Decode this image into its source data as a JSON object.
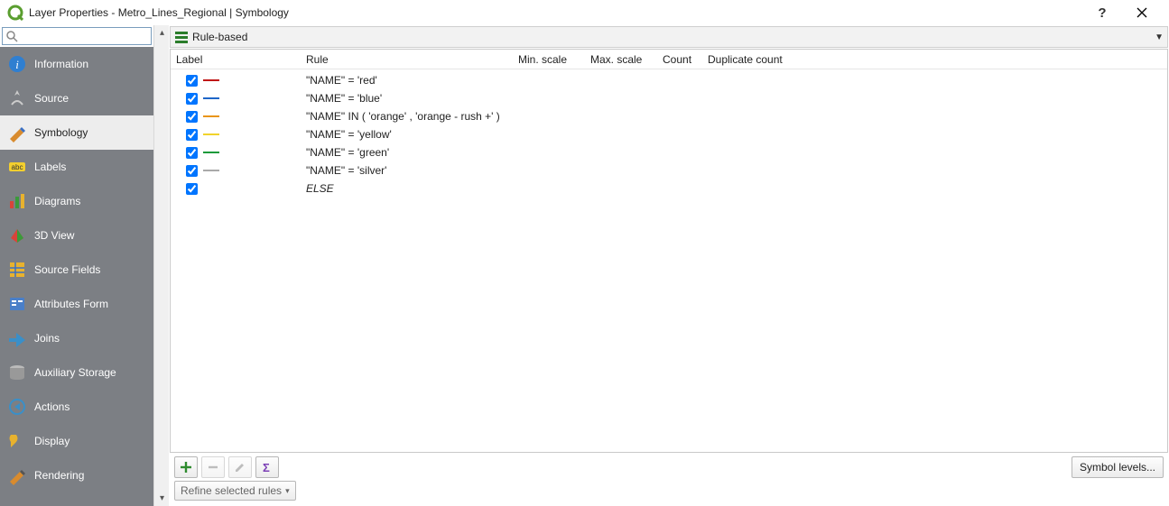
{
  "titlebar": {
    "title": "Layer Properties - Metro_Lines_Regional | Symbology"
  },
  "sidebar": {
    "search_placeholder": "",
    "items": [
      {
        "label": "Information"
      },
      {
        "label": "Source"
      },
      {
        "label": "Symbology"
      },
      {
        "label": "Labels"
      },
      {
        "label": "Diagrams"
      },
      {
        "label": "3D View"
      },
      {
        "label": "Source Fields"
      },
      {
        "label": "Attributes Form"
      },
      {
        "label": "Joins"
      },
      {
        "label": "Auxiliary Storage"
      },
      {
        "label": "Actions"
      },
      {
        "label": "Display"
      },
      {
        "label": "Rendering"
      }
    ],
    "active_index": 2
  },
  "renderer": {
    "label": "Rule-based"
  },
  "table": {
    "headers": {
      "label": "Label",
      "rule": "Rule",
      "min": "Min. scale",
      "max": "Max. scale",
      "count": "Count",
      "dup": "Duplicate count"
    },
    "rows": [
      {
        "checked": true,
        "color": "#c01717",
        "label": "",
        "rule": "\"NAME\"  = 'red'",
        "else": false
      },
      {
        "checked": true,
        "color": "#1e66c8",
        "label": "",
        "rule": "\"NAME\"  = 'blue'",
        "else": false
      },
      {
        "checked": true,
        "color": "#e9951a",
        "label": "",
        "rule": "\"NAME\" IN ( 'orange' ,  'orange - rush +' )",
        "else": false
      },
      {
        "checked": true,
        "color": "#f1d32b",
        "label": "",
        "rule": "\"NAME\"  = 'yellow'",
        "else": false
      },
      {
        "checked": true,
        "color": "#189a3a",
        "label": "",
        "rule": "\"NAME\"  = 'green'",
        "else": false
      },
      {
        "checked": true,
        "color": "#a9a9a9",
        "label": "",
        "rule": "\"NAME\"  = 'silver'",
        "else": false
      },
      {
        "checked": true,
        "color": null,
        "label": "",
        "rule": "ELSE",
        "else": true
      }
    ]
  },
  "buttons": {
    "symbol_levels": "Symbol levels...",
    "refine": "Refine selected rules"
  }
}
